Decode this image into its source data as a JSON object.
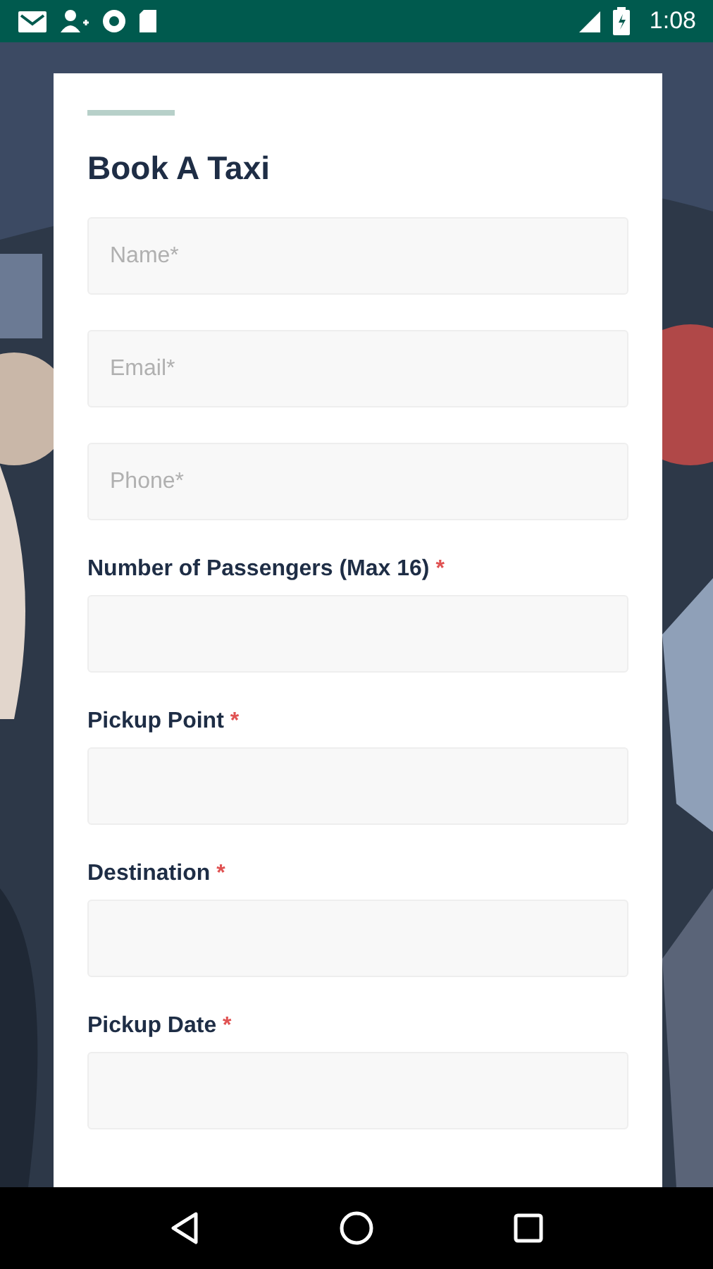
{
  "status_bar": {
    "time": "1:08"
  },
  "form": {
    "title": "Book A Taxi",
    "fields": [
      {
        "kind": "placeholder",
        "placeholder": "Name*"
      },
      {
        "kind": "placeholder",
        "placeholder": "Email*"
      },
      {
        "kind": "placeholder",
        "placeholder": "Phone*"
      },
      {
        "kind": "labelled",
        "label": "Number of Passengers (Max 16)",
        "required_mark": "*"
      },
      {
        "kind": "labelled",
        "label": "Pickup Point",
        "required_mark": "*"
      },
      {
        "kind": "labelled",
        "label": "Destination",
        "required_mark": "*"
      },
      {
        "kind": "labelled",
        "label": "Pickup Date",
        "required_mark": "*"
      }
    ]
  }
}
